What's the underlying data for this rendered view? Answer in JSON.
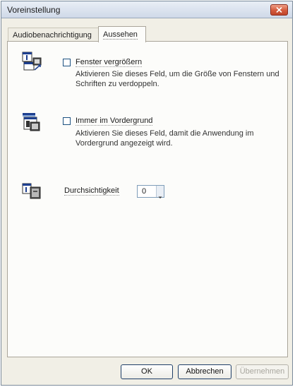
{
  "window": {
    "title": "Voreinstellung"
  },
  "tabs": [
    {
      "label": "Audiobenachrichtigung",
      "active": false
    },
    {
      "label": "Aussehen",
      "active": true
    }
  ],
  "options": [
    {
      "icon": "enlarge-window-icon",
      "label": "Fenster vergrößern",
      "checked": false,
      "description_lines": [
        "Aktivieren Sie dieses Feld, um die Größe von Fenstern und",
        "Schriften zu verdoppeln."
      ]
    },
    {
      "icon": "always-on-top-icon",
      "label": "Immer im Vordergrund",
      "checked": false,
      "description_lines": [
        "Aktivieren Sie dieses Feld, damit die Anwendung im",
        "Vordergrund angezeigt wird."
      ]
    }
  ],
  "transparency": {
    "icon": "transparency-icon",
    "label": "Durchsichtigkeit",
    "value": "0"
  },
  "buttons": {
    "ok": "OK",
    "cancel": "Abbrechen",
    "apply": "Übernehmen",
    "apply_enabled": false
  },
  "colors": {
    "window_bg": "#f1efe6",
    "panel_bg": "#fcfcfa",
    "close_button": "#d45a3c",
    "checkbox_border": "#1c5180"
  }
}
